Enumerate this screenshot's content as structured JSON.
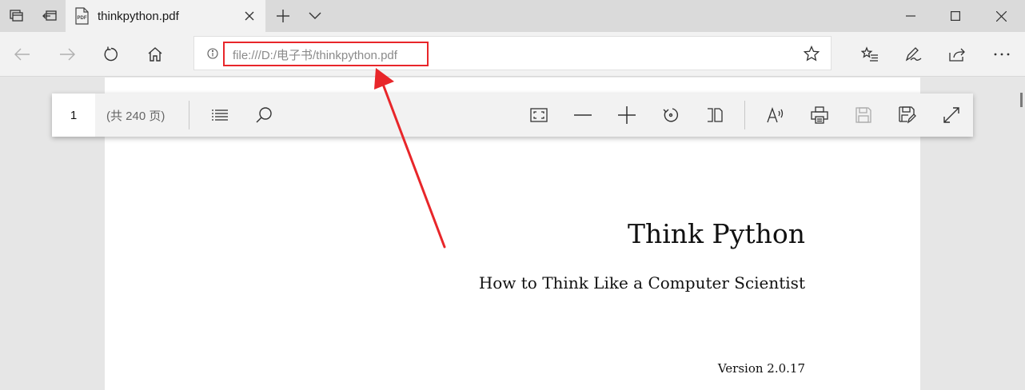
{
  "tab": {
    "title": "thinkpython.pdf"
  },
  "address": {
    "url": "file:///D:/电子书/thinkpython.pdf"
  },
  "pdf_toolbar": {
    "page_current": "1",
    "page_total": "(共 240 页)"
  },
  "document": {
    "title": "Think Python",
    "subtitle": "How to Think Like a Computer Scientist",
    "version": "Version 2.0.17"
  },
  "colors": {
    "annotation_red": "#e8262a",
    "tab_active_bg": "#f2f2f2",
    "titlebar_bg": "#dadada",
    "viewer_bg": "#e6e6e6"
  },
  "icons": {
    "titlebar": [
      "tab-list-icon",
      "tabs-aside-icon",
      "pdf-file-icon",
      "close-icon",
      "plus-icon",
      "chevron-down-icon"
    ],
    "window": [
      "minimize-icon",
      "maximize-icon",
      "close-icon"
    ],
    "nav": [
      "back-arrow-icon",
      "forward-arrow-icon",
      "refresh-icon",
      "home-icon",
      "info-icon",
      "star-icon",
      "favorites-list-icon",
      "pen-icon",
      "share-icon",
      "more-icon"
    ],
    "pdf": [
      "list-icon",
      "search-icon",
      "fit-page-icon",
      "minus-icon",
      "plus-icon",
      "rotate-icon",
      "page-view-icon",
      "read-aloud-icon",
      "print-icon",
      "save-icon",
      "save-as-icon",
      "fullscreen-icon"
    ]
  }
}
